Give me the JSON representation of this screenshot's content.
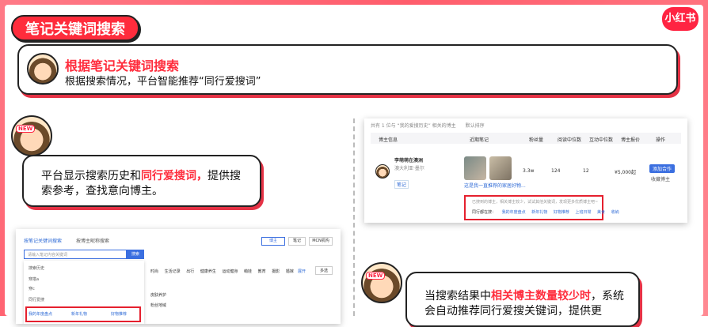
{
  "header": {
    "title": "笔记关键词搜索",
    "logo": "小红书"
  },
  "intro": {
    "title": "根据笔记关键词搜索",
    "subtitle": "根据搜索情况，平台智能推荐“同行爱搜词”"
  },
  "bubble1": {
    "pre": "平台显示搜索历史和",
    "hl": "同行爱搜词，",
    "post": "提供搜索参考，查找意向博主。"
  },
  "bubble2": {
    "pre": "当搜索结果中",
    "hl": "相关博主数量较少时",
    "post": "，系统会自动推荐同行爱搜关键词，提供更"
  },
  "new_tag": "NEW",
  "shot1": {
    "top": [
      "共有 1 位与 “我的爱搜历史” 相关的博主",
      "默认排序"
    ],
    "columns": [
      "博主信息",
      "近期笔记",
      "粉丝量",
      "阅读中位数",
      "互动中位数",
      "博主报价",
      "操作"
    ],
    "row": {
      "name": "李萌萌在澳洲",
      "loc": "澳大利亚·墨尔",
      "followers": "3.3w",
      "reads": "124",
      "interact": "12",
      "price": "¥5,000起",
      "btn_add": "添加合作",
      "btn_fav": "收藏博主",
      "badge": "笔记",
      "note_caption": "这是我一直推荐的家居好物..."
    },
    "tip": "已搜到的博主，相关博主较少，试试其他关键词，发现更多优质博主吧~",
    "rec_label": "同行都在搜：",
    "rec_tags": [
      "我的年度盘点",
      "新年礼物",
      "好物推荐",
      "上班日常",
      "美食",
      "收纳"
    ]
  },
  "shot2": {
    "tabs": [
      "按笔记关键词搜索",
      "按博主昵称搜索"
    ],
    "placeholder": "请输入笔记内容关键词",
    "search_btn": "搜索",
    "history_label": "搜索历史",
    "history": [
      "穿搭a",
      "穿c"
    ],
    "peer_label": "同行爱搜",
    "peer": [
      "我的年度盘点",
      "新年礼物",
      "好物推荐"
    ],
    "cats": [
      "时尚",
      "生活记录",
      "出行",
      "健康养生",
      "运动健身",
      "萌娃",
      "教育",
      "摄影",
      "婚嫁"
    ],
    "filter1": "皮肤养护",
    "filter2": "粉丝地域",
    "more": "展开",
    "more2": "多选",
    "right_btns": [
      "博主",
      "笔记",
      "MCN机构"
    ]
  }
}
